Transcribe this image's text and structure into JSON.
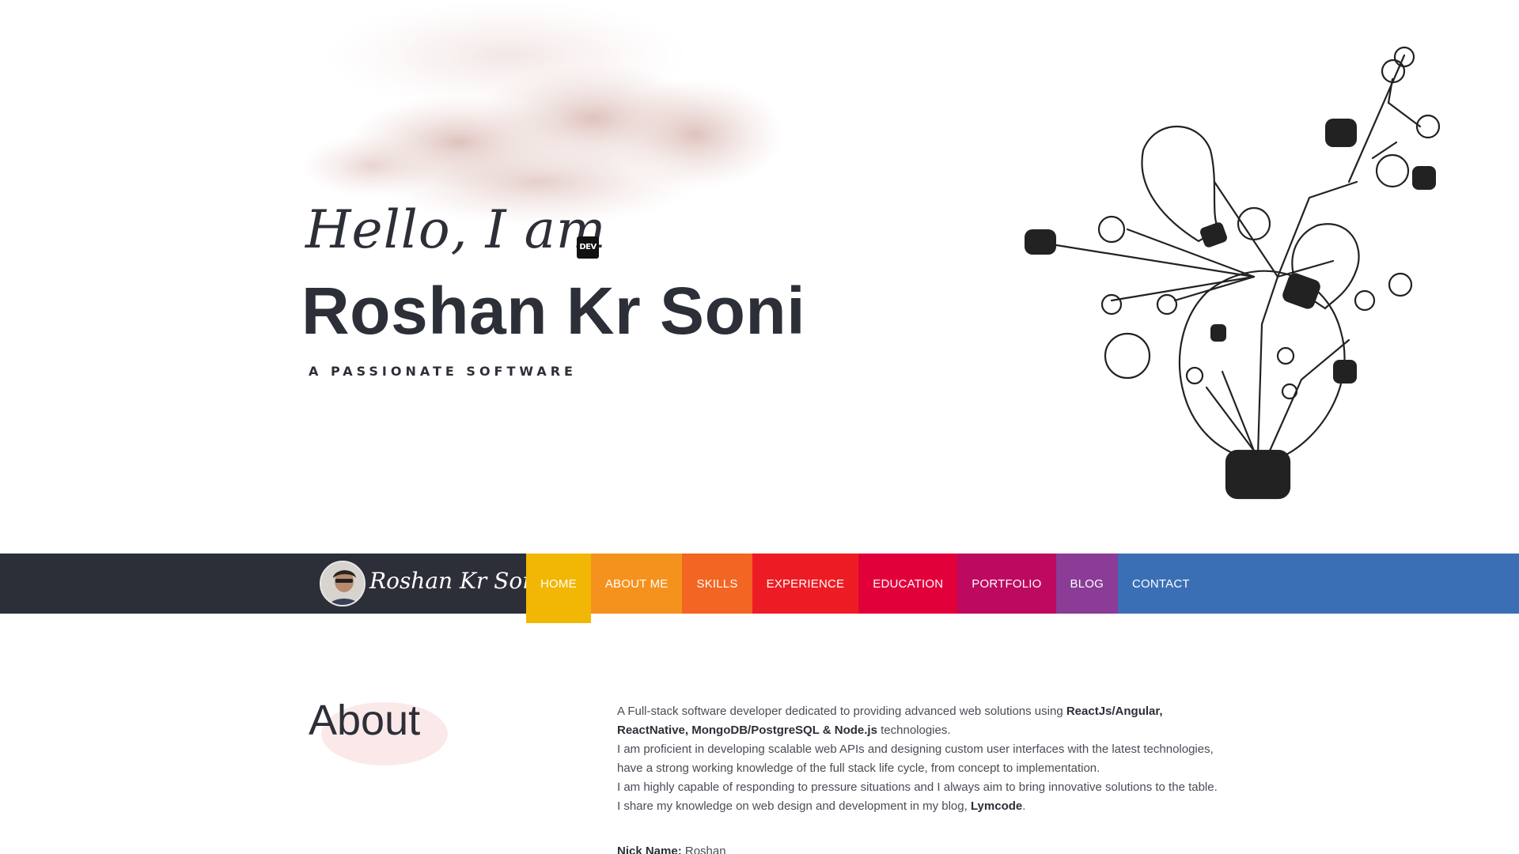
{
  "hero": {
    "greeting": "Hello, I am",
    "badge": "DEV",
    "name": "Roshan Kr Soni",
    "tagline": "A PASSIONATE SOFTWARE"
  },
  "navbar": {
    "signature": "Roshan Kr Soni",
    "items": [
      {
        "label": "HOME",
        "color": "#f2b705",
        "active": true
      },
      {
        "label": "ABOUT ME",
        "color": "#f5921e"
      },
      {
        "label": "SKILLS",
        "color": "#f26522"
      },
      {
        "label": "EXPERIENCE",
        "color": "#ed1c24"
      },
      {
        "label": "EDUCATION",
        "color": "#e2003b"
      },
      {
        "label": "PORTFOLIO",
        "color": "#bd0a60"
      },
      {
        "label": "BLOG",
        "color": "#8a3c96"
      },
      {
        "label": "CONTACT",
        "color": "#3b6fb5"
      }
    ]
  },
  "about": {
    "title": "About",
    "p1_start": "A Full-stack software developer dedicated to providing advanced web solutions using ",
    "p1_bold": "ReactJs/Angular, ReactNative, MongoDB/PostgreSQL & Node.js",
    "p1_end": " technologies.",
    "p2": "I am proficient in developing scalable web APIs and designing custom user interfaces with the latest technologies, have a strong working knowledge of the full stack life cycle, from concept to implementation.",
    "p3": "I am highly capable of responding to pressure situations and I always aim to bring innovative solutions to the table.",
    "p4_start": "I share my knowledge on web design and development in my blog, ",
    "p4_bold": "Lymcode",
    "p4_end": ".",
    "nick_label": "Nick Name:",
    "nick_value": " Roshan"
  }
}
